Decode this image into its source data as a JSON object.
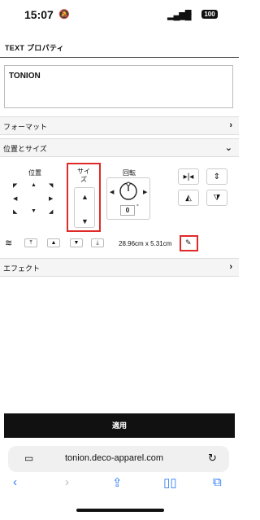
{
  "status": {
    "time": "15:07",
    "battery": "100"
  },
  "header": {
    "title": "TEXT プロパティ"
  },
  "text_value": "TONION",
  "rows": {
    "format": "フォーマット",
    "position_size": "位置とサイズ",
    "effect": "エフェクト"
  },
  "position_panel": {
    "label": "位置"
  },
  "size_panel": {
    "label": "サイ\nズ"
  },
  "rotation_panel": {
    "label": "回転",
    "value": "0",
    "unit": "°"
  },
  "dimensions": "28.96cm x 5.31cm",
  "apply_label": "適用",
  "browser": {
    "url": "tonion.deco-apparel.com"
  },
  "colors": {
    "accent": "#2f7cf6",
    "highlight": "#e02a2a"
  }
}
